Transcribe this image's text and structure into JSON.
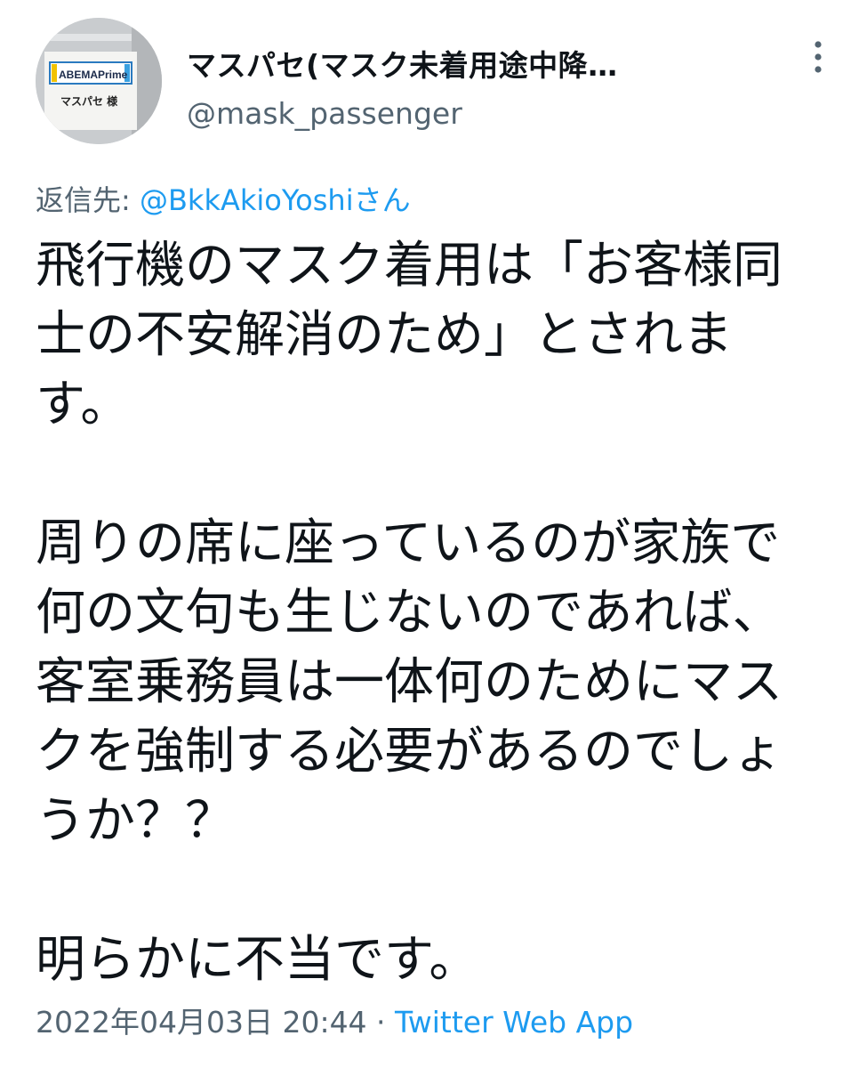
{
  "author": {
    "display_name": "マスパセ(マスク未着用途中降…",
    "handle": "@mask_passenger",
    "avatar_sign_text": "ABEMAPrime",
    "avatar_name_text": "マスパセ 様"
  },
  "reply": {
    "prefix": "返信先: ",
    "mention": "@BkkAkioYoshiさん"
  },
  "tweet": {
    "paragraph1_lines": [
      "飛行機のマスク着用は「お客様同",
      "士の不安解消のため」とされま",
      "す。"
    ],
    "paragraph2_lines": [
      "周りの席に座っているのが家族で",
      "何の文句も生じないのであれば、",
      "客室乗務員は一体何のためにマス",
      "クを強制する必要があるのでしょ",
      "うか？？"
    ],
    "paragraph3_lines": [
      "明らかに不当です。"
    ]
  },
  "meta": {
    "timestamp": "2022年04月03日 20:44",
    "separator": " · ",
    "source": "Twitter Web App"
  },
  "icons": {
    "more": "more-vertical-icon"
  },
  "colors": {
    "text": "#0f1419",
    "secondary": "#536471",
    "link": "#1d9bf0"
  }
}
